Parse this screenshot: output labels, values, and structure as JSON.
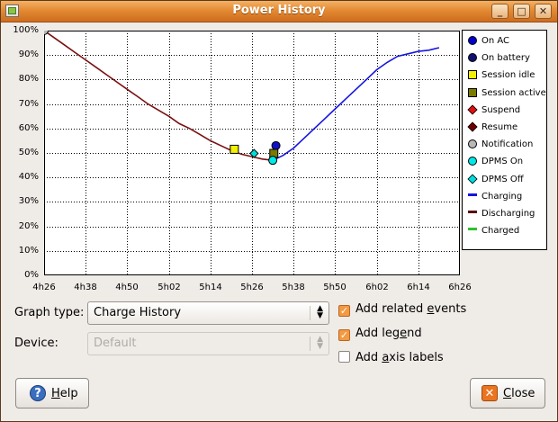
{
  "window": {
    "title": "Power History"
  },
  "titlebar_buttons": {
    "minimize": "_",
    "maximize": "□",
    "close": "✕"
  },
  "chart_data": {
    "type": "line",
    "ylim": [
      0,
      100
    ],
    "yticks": [
      "100%",
      "90%",
      "80%",
      "70%",
      "60%",
      "50%",
      "40%",
      "30%",
      "20%",
      "10%",
      "0%"
    ],
    "xticks": [
      "4h26",
      "4h38",
      "4h50",
      "5h02",
      "5h14",
      "5h26",
      "5h38",
      "5h50",
      "6h02",
      "6h14",
      "6h26"
    ],
    "grid": true,
    "series": [
      {
        "name": "Discharging",
        "color": "#7a1010",
        "points": [
          [
            0,
            100
          ],
          [
            1,
            97
          ],
          [
            2,
            94
          ],
          [
            3,
            91
          ],
          [
            4,
            88
          ],
          [
            5,
            85
          ],
          [
            6,
            82
          ],
          [
            7,
            79
          ],
          [
            8,
            76
          ],
          [
            9,
            73
          ],
          [
            10,
            70
          ],
          [
            11,
            67.5
          ],
          [
            12,
            65
          ],
          [
            13,
            62
          ],
          [
            14,
            60
          ],
          [
            15,
            57.5
          ],
          [
            16,
            55
          ],
          [
            17,
            53
          ],
          [
            18,
            51
          ],
          [
            19,
            49.5
          ],
          [
            20,
            48.5
          ],
          [
            21,
            47.5
          ],
          [
            22,
            47
          ]
        ]
      },
      {
        "name": "Charging",
        "color": "#1515e0",
        "points": [
          [
            22,
            47
          ],
          [
            23,
            49
          ],
          [
            24,
            52
          ],
          [
            25,
            56
          ],
          [
            26,
            60
          ],
          [
            27,
            64
          ],
          [
            28,
            68
          ],
          [
            29,
            72
          ],
          [
            30,
            76
          ],
          [
            31,
            80
          ],
          [
            32,
            84
          ],
          [
            33,
            87
          ],
          [
            34,
            89.5
          ],
          [
            35,
            90.5
          ],
          [
            36,
            91.5
          ],
          [
            37,
            92
          ],
          [
            38,
            93
          ]
        ]
      }
    ],
    "markers": [
      {
        "name": "Notification",
        "x": 0,
        "y": 100,
        "shape": "circle",
        "color": "#b8b8b8"
      },
      {
        "name": "Session idle",
        "x": 18.3,
        "y": 51.5,
        "shape": "square",
        "color": "#f0f000"
      },
      {
        "name": "DPMS Off",
        "x": 20.2,
        "y": 49.8,
        "shape": "diamond",
        "color": "#00dcdc"
      },
      {
        "name": "On battery",
        "x": 22.3,
        "y": 53,
        "shape": "circle",
        "color": "#1010c8"
      },
      {
        "name": "Session active",
        "x": 22.1,
        "y": 49.8,
        "shape": "square",
        "color": "#7a7a00"
      },
      {
        "name": "DPMS On",
        "x": 22,
        "y": 47,
        "shape": "circle",
        "color": "#00e8e8"
      }
    ],
    "x_count": 40
  },
  "legend": [
    {
      "label": "On AC",
      "shape": "circle",
      "color": "#0000cc"
    },
    {
      "label": "On battery",
      "shape": "circle",
      "color": "#101070"
    },
    {
      "label": "Session idle",
      "shape": "square",
      "color": "#f0f000"
    },
    {
      "label": "Session active",
      "shape": "square",
      "color": "#7a7a00"
    },
    {
      "label": "Suspend",
      "shape": "diamond",
      "color": "#e01010"
    },
    {
      "label": "Resume",
      "shape": "diamond",
      "color": "#700000"
    },
    {
      "label": "Notification",
      "shape": "circle",
      "color": "#b8b8b8"
    },
    {
      "label": "DPMS On",
      "shape": "circle",
      "color": "#00e8e8"
    },
    {
      "label": "DPMS Off",
      "shape": "diamond",
      "color": "#00dcdc"
    },
    {
      "label": "Charging",
      "shape": "line",
      "color": "#1515e0"
    },
    {
      "label": "Discharging",
      "shape": "line",
      "color": "#5a1010"
    },
    {
      "label": "Charged",
      "shape": "line",
      "color": "#30c030"
    }
  ],
  "form": {
    "graph_type_label": "Graph type:",
    "graph_type_value": "Charge History",
    "device_label": "Device:",
    "device_value": "Default"
  },
  "options": {
    "related_events": {
      "pre": "Add related ",
      "u": "e",
      "post": "vents",
      "checked": true
    },
    "legend": {
      "pre": "Add leg",
      "u": "e",
      "post": "nd",
      "checked": true
    },
    "axis_labels": {
      "pre": "Add ",
      "u": "a",
      "post": "xis labels",
      "checked": false
    }
  },
  "buttons": {
    "help": {
      "u": "H",
      "post": "elp"
    },
    "close": {
      "u": "C",
      "post": "lose"
    }
  }
}
